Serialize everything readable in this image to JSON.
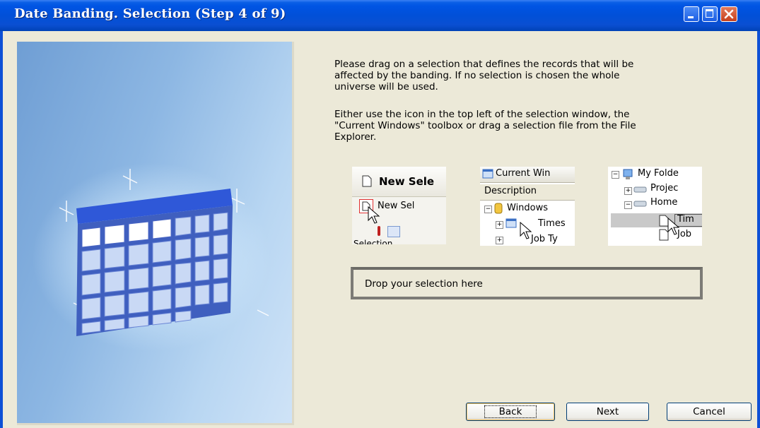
{
  "window": {
    "title": "Date Banding.  Selection (Step 4 of 9)",
    "controls": [
      "minimize-icon",
      "maximize-icon",
      "close-icon"
    ]
  },
  "instructions": {
    "paragraph1": "Please drag on a selection that defines the records that will be\naffected by the banding.  If no selection is chosen the whole\nuniverse will be used.",
    "paragraph2": "Either use the icon in the top left of the selection window, the\n\"Current Windows\" toolbox or drag a selection file from the File\nExplorer."
  },
  "illustrations": {
    "shot1": {
      "title": "New Sele",
      "item": "New Sel",
      "footer": "Selection"
    },
    "shot2": {
      "title": "Current Win",
      "column": "Description",
      "node": "Windows",
      "child1": "Times",
      "child2": "Job Ty"
    },
    "shot3": {
      "root": "My Folde",
      "node1": "Projec",
      "node2": "Home",
      "child1": "Tim",
      "child2": "Job"
    }
  },
  "dropzone": {
    "text": "Drop your selection here"
  },
  "buttons": {
    "back": "Back",
    "next": "Next",
    "cancel": "Cancel"
  },
  "colors": {
    "titlebar": "#0054e3",
    "dialog_bg": "#ece9d8",
    "dropzone_border": "#7c7b76",
    "close_button": "#c6401d"
  }
}
